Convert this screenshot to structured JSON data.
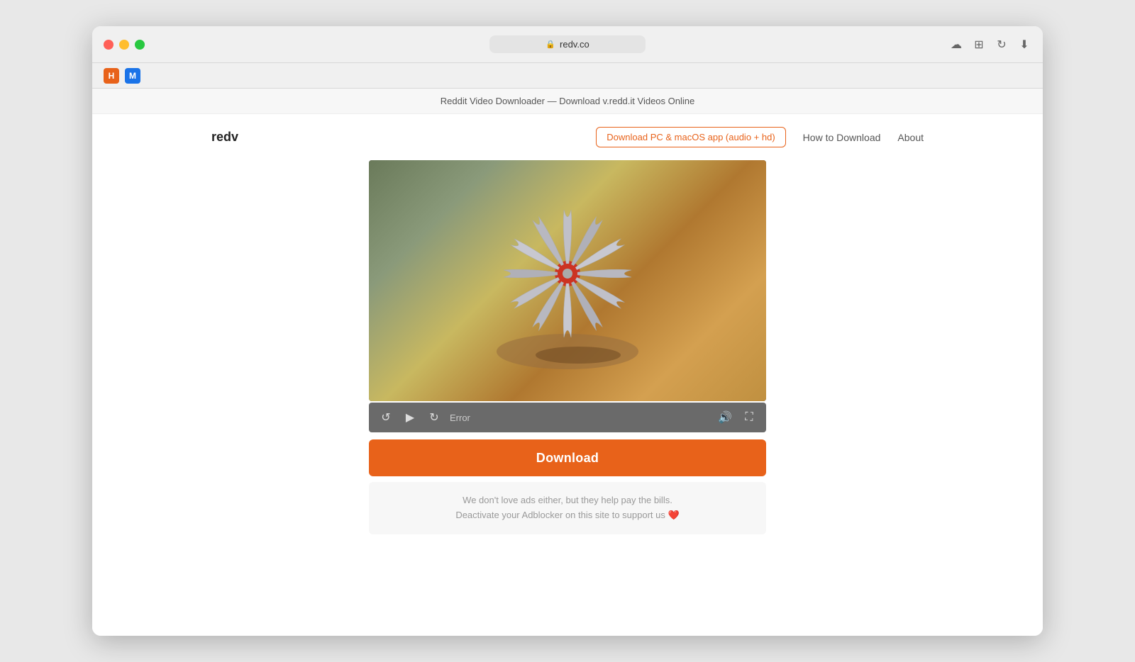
{
  "browser": {
    "url": "redv.co",
    "tab_title": "Reddit Video Downloader — Download v.redd.it Videos Online",
    "traffic_lights": {
      "red": "close",
      "yellow": "minimize",
      "green": "maximize"
    }
  },
  "nav": {
    "logo": "redv",
    "cta_button": "Download PC & macOS app (audio + hd)",
    "how_to": "How to Download",
    "about": "About"
  },
  "video": {
    "controls": {
      "rewind_label": "⟲",
      "play_label": "▶",
      "forward_label": "⟳",
      "error_text": "Error",
      "volume_label": "🔊",
      "fullscreen_label": "⛶"
    }
  },
  "download_button": "Download",
  "ad_notice": {
    "line1": "We don't love ads either, but they help pay the bills.",
    "line2": "Deactivate your Adblocker on this site to support us ❤️"
  }
}
